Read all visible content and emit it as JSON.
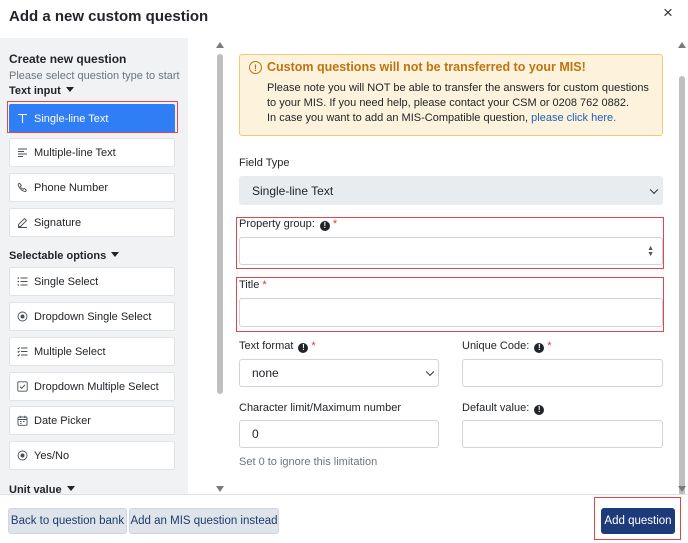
{
  "modal": {
    "title": "Add a new custom question",
    "close_label": "×"
  },
  "sidebar": {
    "title": "Create new question",
    "subtitle": "Please select question type to start",
    "sections": [
      {
        "label": "Text input"
      },
      {
        "label": "Selectable options"
      },
      {
        "label": "Unit value"
      }
    ],
    "items": [
      {
        "label": "Single-line Text",
        "icon": "text-cursor-icon",
        "active": true
      },
      {
        "label": "Multiple-line Text",
        "icon": "lines-icon"
      },
      {
        "label": "Phone Number",
        "icon": "phone-icon"
      },
      {
        "label": "Signature",
        "icon": "pen-icon"
      },
      {
        "label": "Single Select",
        "icon": "list-icon"
      },
      {
        "label": "Dropdown Single Select",
        "icon": "radio-icon"
      },
      {
        "label": "Multiple Select",
        "icon": "checklist-icon"
      },
      {
        "label": "Dropdown Multiple Select",
        "icon": "checkbox-icon"
      },
      {
        "label": "Date Picker",
        "icon": "calendar-icon"
      },
      {
        "label": "Yes/No",
        "icon": "radio-icon"
      }
    ]
  },
  "warning": {
    "title": "Custom questions will not be transferred to your MIS!",
    "body": "Please note you will NOT be able to transfer the answers for custom questions to your MIS. If you need help, please contact your CSM or 0208 762 0882.",
    "line3_text": "In case you want to add an MIS-Compatible question,",
    "line3_link": "please click here."
  },
  "form": {
    "field_type": {
      "label": "Field Type",
      "value": "Single-line Text"
    },
    "property_group": {
      "label": "Property group:",
      "required": "*",
      "value": ""
    },
    "title": {
      "label": "Title",
      "required": "*",
      "value": ""
    },
    "text_format": {
      "label": "Text format",
      "required": "*",
      "value": "none"
    },
    "unique_code": {
      "label": "Unique Code:",
      "required": "*",
      "value": ""
    },
    "char_limit": {
      "label": "Character limit/Maximum number",
      "value": "0",
      "hint": "Set 0 to ignore this limitation"
    },
    "default_value": {
      "label": "Default value:",
      "value": ""
    }
  },
  "footer": {
    "back_label": "Back to question bank",
    "mis_label": "Add an MIS question instead",
    "add_label": "Add question"
  },
  "colors": {
    "accent": "#2f7ef6",
    "primary_button": "#1d3a7a",
    "warning_title": "#c0730f",
    "highlight_box": "#e0464c"
  }
}
